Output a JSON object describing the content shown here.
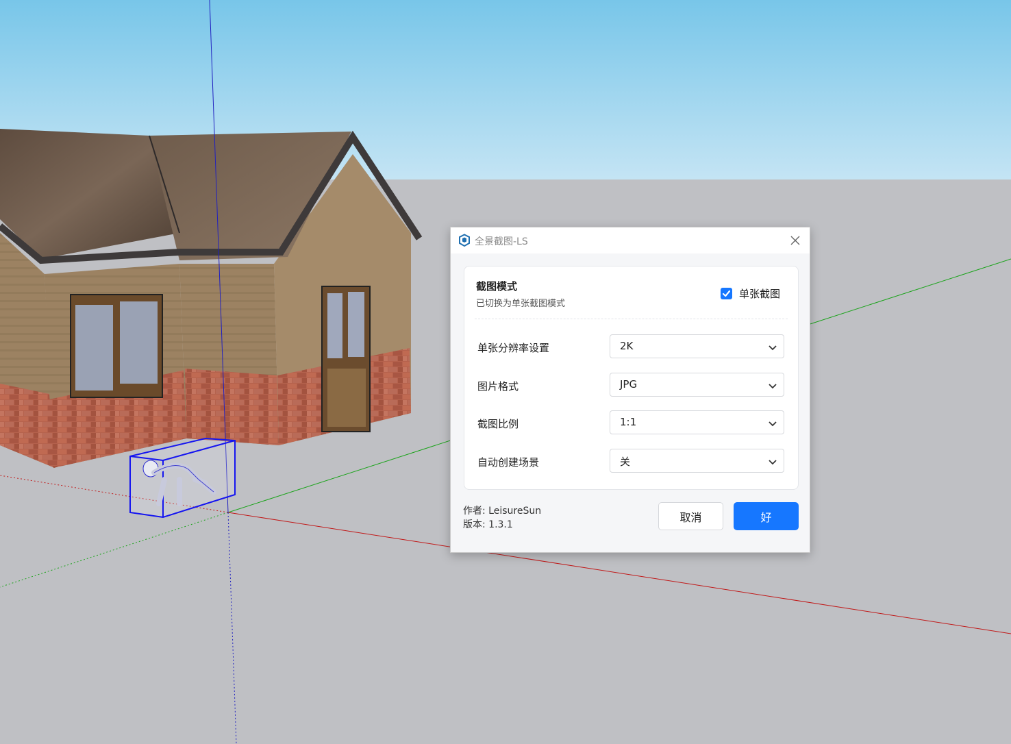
{
  "dialog": {
    "title": "全景截图-LS",
    "icon": "sketchup-logo-icon",
    "close_icon": "close-icon"
  },
  "mode": {
    "title": "截图模式",
    "subtitle": "已切换为单张截图模式",
    "checkbox_label": "单张截图",
    "checked": true
  },
  "settings": [
    {
      "label": "单张分辨率设置",
      "value": "2K"
    },
    {
      "label": "图片格式",
      "value": "JPG"
    },
    {
      "label": "截图比例",
      "value": "1:1"
    },
    {
      "label": "自动创建场景",
      "value": "关"
    }
  ],
  "footer": {
    "author": "作者: LeisureSun",
    "version": "版本: 1.3.1",
    "cancel_label": "取消",
    "ok_label": "好"
  },
  "colors": {
    "accent": "#1677ff",
    "sky_top": "#7fc8ea",
    "ground": "#bfc0c4"
  }
}
